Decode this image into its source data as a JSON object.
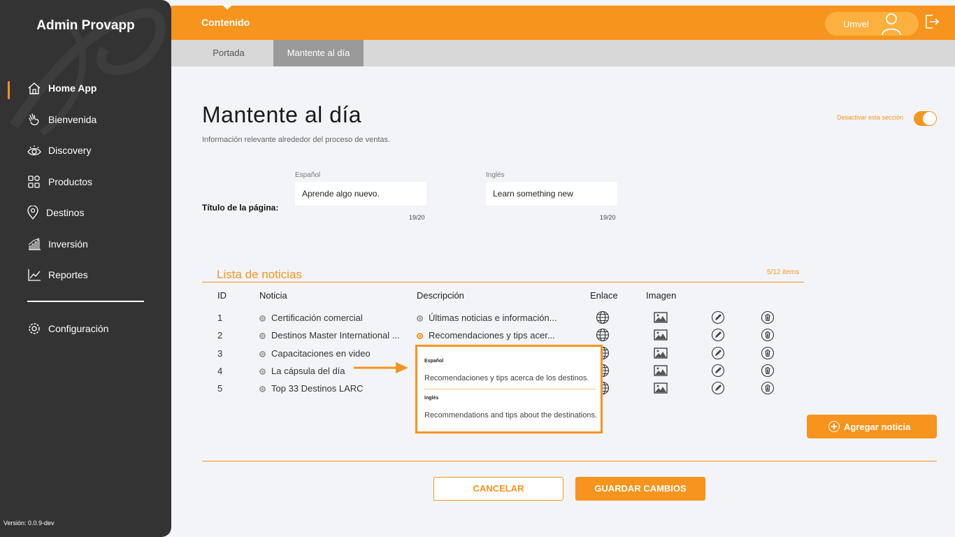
{
  "sidebar": {
    "brand": "Admin Provapp",
    "items": [
      {
        "label": "Home App",
        "icon": "home-icon"
      },
      {
        "label": "Bienvenida",
        "icon": "waving-hand-icon"
      },
      {
        "label": "Discovery",
        "icon": "eye-icon"
      },
      {
        "label": "Productos",
        "icon": "grid-icon"
      },
      {
        "label": "Destinos",
        "icon": "location-pin-icon"
      },
      {
        "label": "Inversión",
        "icon": "bar-chart-icon"
      },
      {
        "label": "Reportes",
        "icon": "line-chart-icon"
      },
      {
        "label": "Configuración",
        "icon": "gear-icon"
      }
    ],
    "version": "Versión: 0.0.9-dev"
  },
  "header": {
    "title": "Contenido",
    "user_name": "Umvel"
  },
  "tabs": [
    {
      "label": "Portada"
    },
    {
      "label": "Mantente al día"
    }
  ],
  "main": {
    "title": "Mantente al día",
    "subtitle": "Información relevante alrededor del proceso de ventas.",
    "toggle_label": "Desactivar esta sección",
    "page_title_label": "Título de la página:",
    "spanish_label": "Español",
    "english_label": "Inglés",
    "spanish_value": "Aprende algo nuevo.",
    "english_value": "Learn something new",
    "spanish_counter": "19/20",
    "english_counter": "19/20"
  },
  "news": {
    "section_title": "Lista de noticias",
    "items_count": "5/12 items",
    "headers": {
      "id": "ID",
      "noticia": "Noticia",
      "descripcion": "Descripción",
      "enlace": "Enlace",
      "imagen": "Imagen"
    },
    "rows": [
      {
        "id": "1",
        "noticia": "Certificación comercial",
        "descripcion": "Últimas noticias e información..."
      },
      {
        "id": "2",
        "noticia": "Destinos Master International ...",
        "descripcion": "Recomendaciones y tips acer..."
      },
      {
        "id": "3",
        "noticia": "Capacitaciones en video",
        "descripcion": ""
      },
      {
        "id": "4",
        "noticia": "La cápsula del día",
        "descripcion": ""
      },
      {
        "id": "5",
        "noticia": "Top 33 Destinos LARC",
        "descripcion": ""
      }
    ],
    "popover": {
      "spanish_label": "Español",
      "spanish_text": "Recomendaciones y tips acerca de los destinos.",
      "english_label": "Inglés",
      "english_text": "Recommendations and tips about the destinations."
    },
    "add_button": "Agregar noticia"
  },
  "actions": {
    "cancel": "CANCELAR",
    "save": "GUARDAR CAMBIOS"
  },
  "colors": {
    "accent": "#f7941d",
    "sidebar": "#333333",
    "background": "#f3f4f8"
  }
}
